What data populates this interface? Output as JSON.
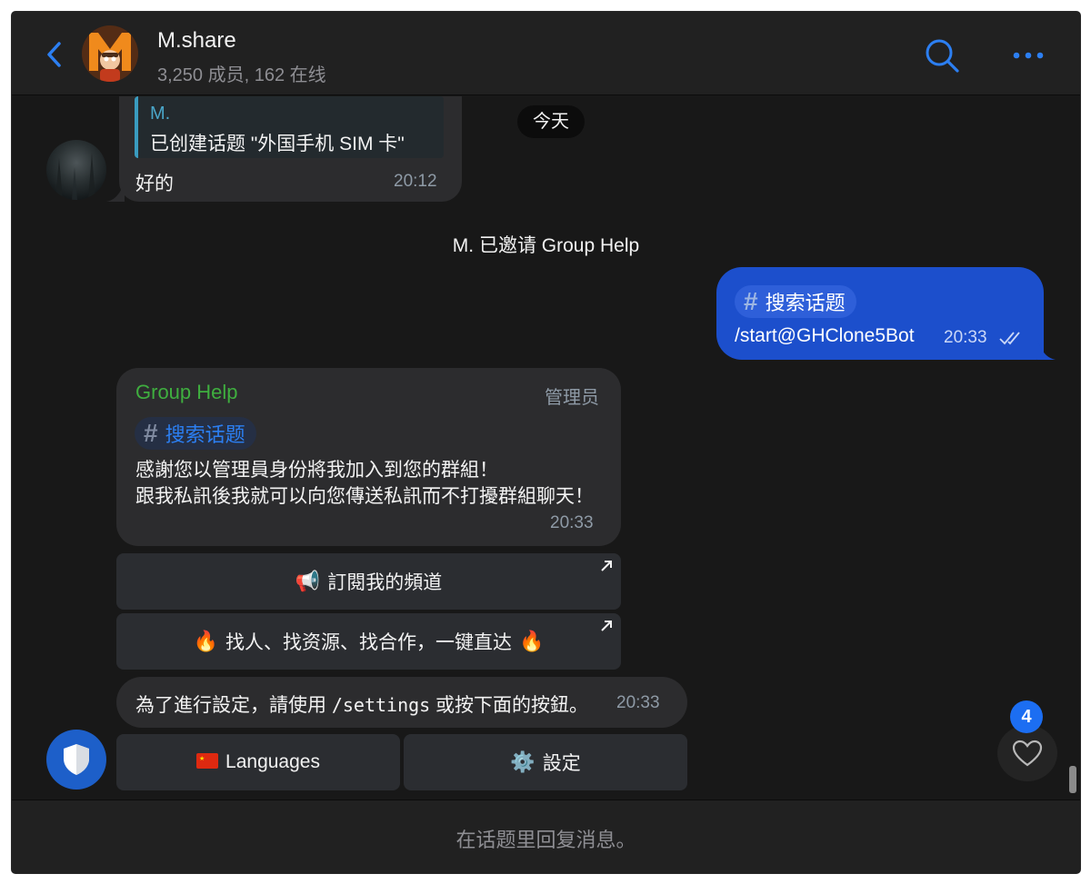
{
  "colors": {
    "accent": "#2c7ff2",
    "outgoing_bubble": "#1c4fcc",
    "incoming_bubble": "#2c2c2e",
    "sender_green": "#3fae3f",
    "reply_bar": "#3a9bbf",
    "background": "#181818"
  },
  "header": {
    "title": "M.share",
    "subtitle": "3,250 成员, 162 在线",
    "back_icon": "chevron-left-icon",
    "search_icon": "search-icon",
    "more_icon": "ellipsis-icon"
  },
  "chat": {
    "date_separator": "今天",
    "message1": {
      "reply_author": "M.",
      "reply_text": "已创建话题 \"外国手机 SIM 卡\"",
      "text": "好的",
      "time": "20:12"
    },
    "service_message": "M. 已邀请  Group Help",
    "outgoing": {
      "topic": "搜索话题",
      "text": "/start@GHClone5Bot",
      "time": "20:33"
    },
    "bot_message": {
      "sender": "Group Help",
      "badge": "管理员",
      "topic": "搜索话题",
      "text": "感謝您以管理員身份將我加入到您的群組！\n跟我私訊後我就可以向您傳送私訊而不打擾群組聊天！",
      "time": "20:33",
      "buttons": [
        {
          "emoji": "📢",
          "label": "訂閱我的頻道"
        },
        {
          "emoji": "🔥",
          "label": "找人、找资源、找合作，一键直达",
          "emoji_after": "🔥"
        }
      ]
    },
    "settings_message": {
      "text_before": "為了進行設定，請使用 ",
      "command": "/settings",
      "text_after": " 或按下面的按鈕。",
      "time": "20:33",
      "buttons": [
        {
          "emoji": "🇨🇳",
          "label": "Languages"
        },
        {
          "emoji": "⚙️",
          "label": "設定"
        }
      ]
    },
    "reaction_count": "4"
  },
  "footer": {
    "placeholder": "在话题里回复消息。"
  }
}
